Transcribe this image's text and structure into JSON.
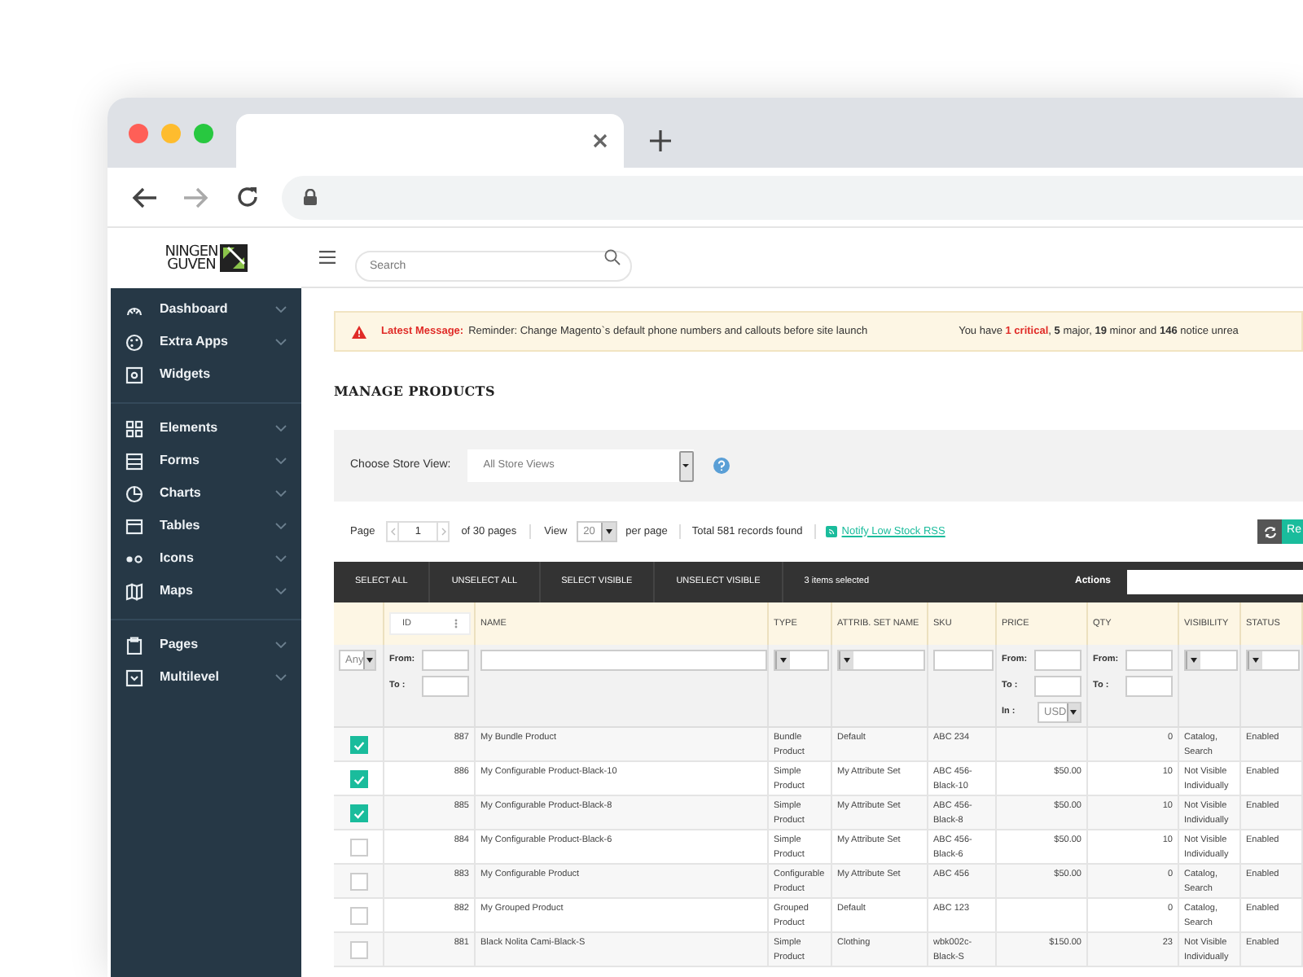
{
  "sidebar": {
    "logo": [
      "NINGEN",
      "GUVEN"
    ],
    "groups": [
      [
        {
          "label": "Dashboard",
          "has_submenu": true
        },
        {
          "label": "Extra Apps",
          "has_submenu": true
        },
        {
          "label": "Widgets",
          "has_submenu": false
        }
      ],
      [
        {
          "label": "Elements",
          "has_submenu": true
        },
        {
          "label": "Forms",
          "has_submenu": true
        },
        {
          "label": "Charts",
          "has_submenu": true
        },
        {
          "label": "Tables",
          "has_submenu": true
        },
        {
          "label": "Icons",
          "has_submenu": true
        },
        {
          "label": "Maps",
          "has_submenu": true
        }
      ],
      [
        {
          "label": "Pages",
          "has_submenu": true
        },
        {
          "label": "Multilevel",
          "has_submenu": true
        }
      ]
    ]
  },
  "header": {
    "search": {
      "placeholder": "Search"
    }
  },
  "alert": {
    "label": "Latest Message:",
    "message": "Reminder: Change Magento`s default phone numbers and callouts before site launch",
    "summary": "You have **1 critical**, **5** major, **19** minor and **146** notice unrea"
  },
  "page_title": "MANAGE PRODUCTS",
  "store_view": {
    "label": "Choose Store View:",
    "value": "All Store Views"
  },
  "pager": {
    "page_label": "Page",
    "page": "1",
    "pages_text": "of 30 pages",
    "view_label": "View",
    "per_page": "20",
    "per_page_label": "per page",
    "total": "Total 581 records found",
    "rss_link": "Notify Low Stock RSS",
    "reset_button": "Re"
  },
  "mass_actions": {
    "buttons": [
      "SELECT ALL",
      "UNSELECT ALL",
      "SELECT VISIBLE",
      "UNSELECT VISIBLE"
    ],
    "selected_count": "3 items selected",
    "actions_label": "Actions"
  },
  "table": {
    "columns": [
      "ID",
      "NAME",
      "TYPE",
      "ATTRIB. SET NAME",
      "SKU",
      "PRICE",
      "QTY",
      "VISIBILITY",
      "STATUS"
    ],
    "filters": {
      "massaction": "Any",
      "id": {
        "from": "From:",
        "to": "To :"
      },
      "price": {
        "from": "From:",
        "to": "To :",
        "in": "In :",
        "currency": "USD"
      },
      "qty": {
        "from": "From:",
        "to": "To :"
      }
    },
    "rows": [
      {
        "checked": true,
        "id": "887",
        "name": "My Bundle Product",
        "type": "Bundle Product",
        "attrib_set": "Default",
        "sku": "ABC 234",
        "qty": "0",
        "visibility": "Catalog, Search",
        "status": "Enabled"
      },
      {
        "checked": true,
        "id": "886",
        "name": "My Configurable Product-Black-10",
        "type": "Simple Product",
        "attrib_set": "My Attribute Set",
        "sku": "ABC 456-Black-10",
        "price": "$50.00",
        "qty": "10",
        "visibility": "Not Visible Individually",
        "status": "Enabled"
      },
      {
        "checked": true,
        "id": "885",
        "name": "My Configurable Product-Black-8",
        "type": "Simple Product",
        "attrib_set": "My Attribute Set",
        "sku": "ABC 456-Black-8",
        "price": "$50.00",
        "qty": "10",
        "visibility": "Not Visible Individually",
        "status": "Enabled"
      },
      {
        "checked": false,
        "id": "884",
        "name": "My Configurable Product-Black-6",
        "type": "Simple Product",
        "attrib_set": "My Attribute Set",
        "sku": "ABC 456-Black-6",
        "price": "$50.00",
        "qty": "10",
        "visibility": "Not Visible Individually",
        "status": "Enabled"
      },
      {
        "checked": false,
        "id": "883",
        "name": "My Configurable Product",
        "type": "Configurable Product",
        "attrib_set": "My Attribute Set",
        "sku": "ABC 456",
        "price": "$50.00",
        "qty": "0",
        "visibility": "Catalog, Search",
        "status": "Enabled"
      },
      {
        "checked": false,
        "id": "882",
        "name": "My Grouped Product",
        "type": "Grouped Product",
        "attrib_set": "Default",
        "sku": "ABC 123",
        "qty": "0",
        "visibility": "Catalog, Search",
        "status": "Enabled"
      },
      {
        "checked": false,
        "id": "881",
        "name": "Black Nolita Cami-Black-S",
        "type": "Simple Product",
        "attrib_set": "Clothing",
        "sku": "wbk002c-Black-S",
        "price": "$150.00",
        "qty": "23",
        "visibility": "Not Visible Individually",
        "status": "Enabled"
      }
    ]
  }
}
